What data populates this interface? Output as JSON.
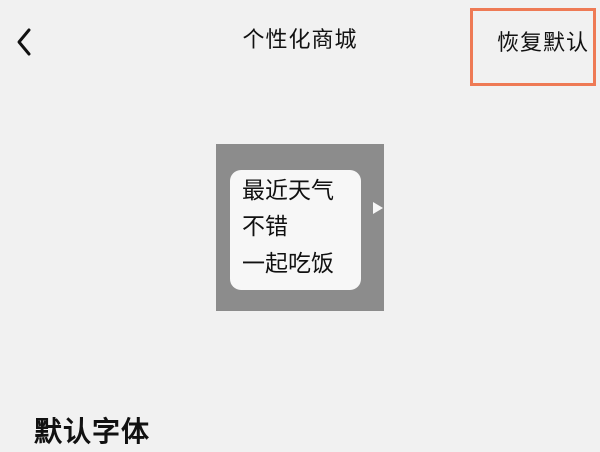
{
  "header": {
    "back_icon": "chevron-left-icon",
    "title": "个性化商城",
    "reset_label": "恢复默认",
    "highlight_color": "#ee7a55"
  },
  "preview": {
    "background_color": "#8c8c8c",
    "bubble_color": "#f7f7f7",
    "lines": [
      "最近天气",
      "不错",
      "一起吃饭"
    ]
  },
  "section": {
    "title": "默认字体"
  }
}
